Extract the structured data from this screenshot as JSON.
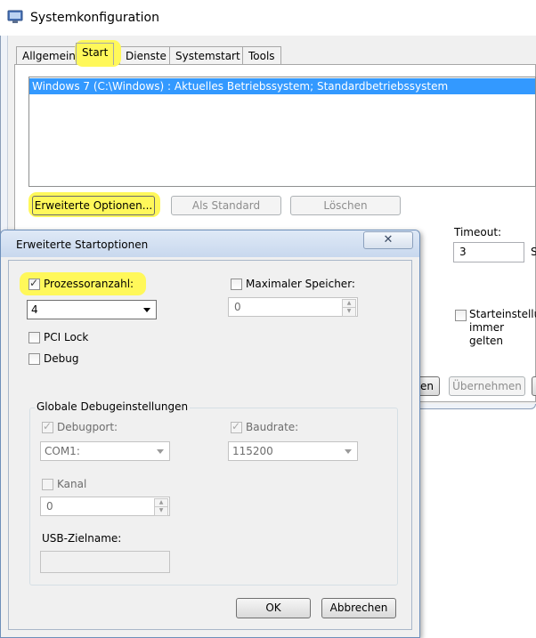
{
  "main_window": {
    "title": "Systemkonfiguration",
    "tabs": [
      "Allgemein",
      "Start",
      "Dienste",
      "Systemstart",
      "Tools"
    ],
    "boot_entry": "Windows 7 (C:\\Windows) : Aktuelles Betriebssystem; Standardbetriebssystem",
    "advanced_button": "Erweiterte Optionen...",
    "set_default_button": "Als Standard",
    "delete_button": "Löschen",
    "timeout_label": "Timeout:",
    "timeout_value": "3",
    "timeout_unit": "S",
    "persist_label_1": "Starteinstellu",
    "persist_label_2": "immer gelten",
    "partial_button": "en",
    "apply_button": "Übernehmen"
  },
  "dialog": {
    "title": "Erweiterte Startoptionen",
    "close_glyph": "✕",
    "num_procs_label": "Prozessoranzahl:",
    "num_procs_value": "4",
    "max_memory_label": "Maximaler Speicher:",
    "max_memory_value": "0",
    "pci_lock_label": "PCI Lock",
    "debug_label": "Debug",
    "global_debug_group": "Globale Debugeinstellungen",
    "debugport_label": "Debugport:",
    "debugport_value": "COM1:",
    "baudrate_label": "Baudrate:",
    "baudrate_value": "115200",
    "channel_label": "Kanal",
    "channel_value": "0",
    "usb_target_label": "USB-Zielname:",
    "usb_target_value": "",
    "ok_button": "OK",
    "cancel_button": "Abbrechen"
  },
  "highlight_color": "#fff85a",
  "selection_color": "#3399ff"
}
